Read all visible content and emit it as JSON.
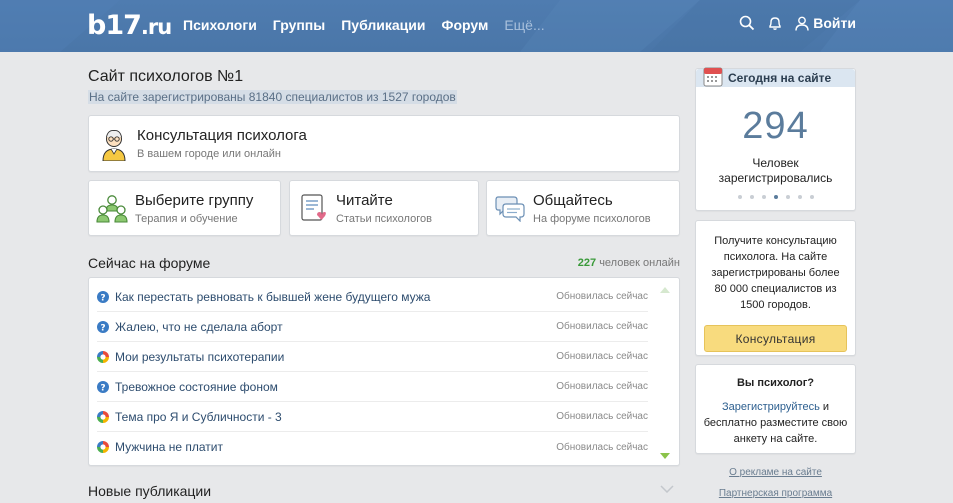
{
  "header": {
    "logo": {
      "main": "b17",
      "dot": ".",
      "tld": "ru"
    },
    "nav": [
      "Психологи",
      "Группы",
      "Публикации",
      "Форум"
    ],
    "more": "Ещё...",
    "login": "Войти"
  },
  "main": {
    "title": "Сайт психологов №1",
    "subtitle": "На сайте зарегистрированы 81840 специалистов из 1527 городов",
    "consult": {
      "title": "Консультация психолога",
      "sub": "В вашем городе или онлайн"
    },
    "tiles": [
      {
        "title": "Выберите группу",
        "sub": "Терапия и обучение"
      },
      {
        "title": "Читайте",
        "sub": "Статьи психологов"
      },
      {
        "title": "Общайтесь",
        "sub": "На форуме психологов"
      }
    ],
    "forum": {
      "heading": "Сейчас на форуме",
      "online_count": "227",
      "online_label": "человек онлайн",
      "rows": [
        {
          "title": "Как перестать ревновать к бывшей жене будущего мужа",
          "status": "Обновилась сейчас",
          "icon": "question-icon"
        },
        {
          "title": "Жалею, что не сделала аборт",
          "status": "Обновилась сейчас",
          "icon": "question-icon"
        },
        {
          "title": "Мои результаты психотерапии",
          "status": "Обновилась сейчас",
          "icon": "discussion-icon"
        },
        {
          "title": "Тревожное состояние фоном",
          "status": "Обновилась сейчас",
          "icon": "question-icon"
        },
        {
          "title": "Тема про Я и Субличности - 3",
          "status": "Обновилась сейчас",
          "icon": "discussion-icon"
        },
        {
          "title": "Мужчина не платит",
          "status": "Обновилась сейчас",
          "icon": "discussion-icon"
        }
      ]
    },
    "publications_heading": "Новые публикации"
  },
  "side": {
    "today": {
      "title": "Сегодня на сайте",
      "count": "294",
      "label_line1": "Человек",
      "label_line2": "зарегистрировались"
    },
    "promo": {
      "text": "Получите консультацию психолога. На сайте зарегистрированы более 80 000 специалистов из 1500 городов.",
      "button": "Консультация"
    },
    "psy": {
      "question": "Вы психолог?",
      "link": "Зарегистрируйтесь",
      "rest": " и бесплатно разместите свою анкету на сайте."
    },
    "ads_link": "О рекламе на сайте",
    "partner_link": "Партнерская программа"
  },
  "colors": {
    "header": "#4a76a8",
    "accent_yellow": "#f8db7e",
    "online_green": "#3a9a3a"
  }
}
